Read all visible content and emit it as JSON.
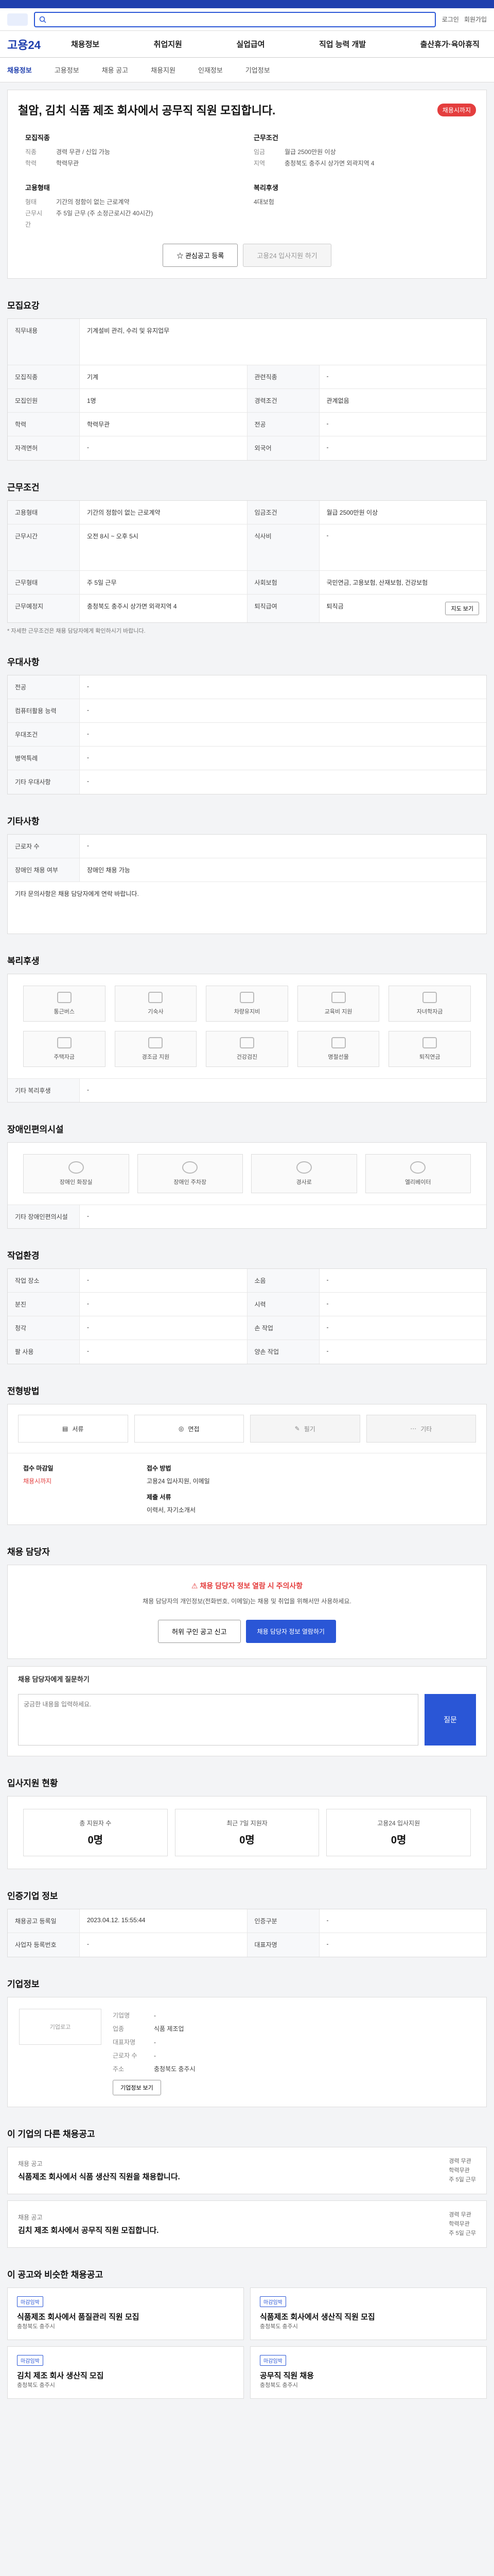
{
  "header": {
    "search_placeholder": "",
    "util": [
      "로그인",
      "회원가입"
    ]
  },
  "brand": "고용24",
  "gnb": [
    "채용정보",
    "취업지원",
    "실업급여",
    "직업 능력 개발",
    "출산휴가·육아휴직"
  ],
  "subnav": [
    "채용정보",
    "고용정보",
    "채용 공고",
    "채용지원",
    "인재정보",
    "기업정보"
  ],
  "job": {
    "deadline": "채용시까지",
    "title": "철암, 김치 식품 제조 회사에서 공무직 직원 모집합니다.",
    "summary": [
      {
        "head": "모집직종",
        "lines": [
          [
            "직종",
            "경력 무관 / 신입 가능"
          ],
          [
            "학력",
            "학력무관"
          ]
        ]
      },
      {
        "head": "근무조건",
        "lines": [
          [
            "임금",
            "월급 2500만원 이상"
          ],
          [
            "지역",
            "충청북도 충주시 상가면 외곽지역 4"
          ]
        ]
      },
      {
        "head": "고용형태",
        "lines": [
          [
            "형태",
            "기간의 정함이 없는 근로계약"
          ],
          [
            "근무시간",
            "주 5일 근무 (주 소정근로시간 40시간)"
          ]
        ]
      },
      {
        "head": "복리후생",
        "lines": [
          [
            "",
            "4대보험"
          ]
        ]
      }
    ],
    "btn_interest": "관심공고 등록",
    "btn_apply": "고용24 입사지원 하기"
  },
  "recruit": {
    "title": "모집요강",
    "duty_label": "직무내용",
    "duty": "기계설비 관리, 수리 및 유지업무",
    "rows": [
      [
        [
          "모집직종",
          "기계"
        ],
        [
          "관련직종",
          "-"
        ]
      ],
      [
        [
          "모집인원",
          "1명"
        ],
        [
          "경력조건",
          "관계없음"
        ]
      ],
      [
        [
          "학력",
          "학력무관"
        ],
        [
          "전공",
          "-"
        ]
      ],
      [
        [
          "자격면허",
          "-"
        ],
        [
          "외국어",
          "-"
        ]
      ]
    ]
  },
  "conditions": {
    "title": "근무조건",
    "rows": [
      [
        [
          "고용형태",
          "기간의 정함이 없는 근로계약"
        ],
        [
          "임금조건",
          "월급 2500만원 이상"
        ]
      ],
      [
        [
          "근무시간",
          "오전 8시 ~ 오후 5시"
        ],
        [
          "식사비",
          "-"
        ]
      ],
      [
        [
          "근무형태",
          "주 5일 근무"
        ],
        [
          "사회보험",
          "국민연금, 고용보험, 산재보험, 건강보험"
        ]
      ],
      [
        [
          "근무예정지",
          "충청북도 충주시 상가면 외곽지역 4"
        ],
        [
          "퇴직급여",
          "퇴직금"
        ]
      ]
    ],
    "map_label": "지도 보기",
    "note": "* 자세한 근무조건은 채용 담당자에게 확인하시기 바랍니다."
  },
  "preference": {
    "title": "우대사항",
    "rows": [
      [
        "전공",
        "-"
      ],
      [
        "컴퓨터활용 능력",
        "-"
      ],
      [
        "우대조건",
        "-"
      ],
      [
        "병역특례",
        "-"
      ],
      [
        "기타 우대사항",
        "-"
      ]
    ]
  },
  "other": {
    "title": "기타사항",
    "rows": [
      [
        "근로자 수",
        "-"
      ],
      [
        "장애인 채용 여부",
        "장애인 채용 가능"
      ]
    ],
    "text": "기타 문의사항은 채용 담당자에게 연락 바랍니다."
  },
  "benefits": {
    "title": "복리후생",
    "items": [
      "통근버스",
      "기숙사",
      "차량유지비",
      "교육비 지원",
      "자녀학자금",
      "주택자금",
      "경조금 지원",
      "건강검진",
      "명절선물",
      "퇴직연금"
    ],
    "other_label": "기타 복리후생",
    "other_value": "-"
  },
  "disability": {
    "title": "장애인편의시설",
    "items": [
      "장애인 화장실",
      "장애인 주차장",
      "경사로",
      "엘리베이터"
    ],
    "other_label": "기타 장애인편의시설",
    "other_value": "-"
  },
  "workplace": {
    "title": "작업환경",
    "rows": [
      [
        [
          "작업 장소",
          "-"
        ],
        [
          "소음",
          "-"
        ]
      ],
      [
        [
          "분진",
          "-"
        ],
        [
          "시력",
          "-"
        ]
      ],
      [
        [
          "청각",
          "-"
        ],
        [
          "손 작업",
          "-"
        ]
      ],
      [
        [
          "팔 사용",
          "-"
        ],
        [
          "양손 작업",
          "-"
        ]
      ]
    ]
  },
  "selection": {
    "title": "전형방법",
    "methods": [
      "서류",
      "면접",
      "필기",
      "기타"
    ],
    "period_label": "접수 마감일",
    "period_value": "채용시까지",
    "apply_label": "접수 방법",
    "apply_value": "고용24 입사지원, 이메일",
    "doc_label": "제출 서류",
    "doc_value": "이력서, 자기소개서"
  },
  "contact": {
    "title": "채용 담당자",
    "warn_title": "채용 담당자 정보 열람 시 주의사항",
    "warn_text": "채용 담당자의 개인정보(전화번호, 이메일)는 채용 및 취업을 위해서만 사용하세요.",
    "btn_view": "채용 담당자 정보 열람하기",
    "btn_report": "허위 구인 공고 신고"
  },
  "qa": {
    "title": "채용 담당자에게 질문하기",
    "placeholder": "궁금한 내용을 입력하세요.",
    "submit": "질문"
  },
  "stats": {
    "title": "입사지원 현황",
    "items": [
      [
        "총 지원자 수",
        "0명"
      ],
      [
        "최근 7일 지원자",
        "0명"
      ],
      [
        "고용24 입사지원",
        "0명"
      ]
    ]
  },
  "info": {
    "title": "인증기업 정보",
    "rows": [
      [
        [
          "채용공고 등록일",
          "2023.04.12. 15:55:44"
        ],
        [
          "인증구분",
          "-"
        ]
      ],
      [
        [
          "사업자 등록번호",
          "-"
        ],
        [
          "대표자명",
          "-"
        ]
      ]
    ]
  },
  "company": {
    "title": "기업정보",
    "logo": "기업로고",
    "rows": [
      [
        "기업명",
        "-"
      ],
      [
        "업종",
        "식품 제조업"
      ],
      [
        "대표자명",
        "-"
      ],
      [
        "근로자 수",
        "-"
      ],
      [
        "주소",
        "충청북도 충주시"
      ]
    ],
    "btn": "기업정보 보기"
  },
  "related": {
    "title": "이 기업의 다른 채용공고",
    "cards": [
      {
        "name": "채용 공고",
        "title": "식품제조 회사에서 식품 생산직 직원을 채용합니다.",
        "meta": [
          "경력 무관",
          "학력무관",
          "주 5일 근무"
        ]
      },
      {
        "name": "채용 공고",
        "title": "김치 제조 회사에서 공무직 직원 모집합니다.",
        "meta": [
          "경력 무관",
          "학력무관",
          "주 5일 근무"
        ]
      }
    ]
  },
  "recommend": {
    "title": "이 공고와 비슷한 채용공고",
    "cards": [
      {
        "badge": "마감임박",
        "title": "식품제조 회사에서 품질관리 직원 모집",
        "meta": "충청북도 충주시"
      },
      {
        "badge": "마감임박",
        "title": "식품제조 회사에서 생산직 직원 모집",
        "meta": "충청북도 충주시"
      },
      {
        "badge": "마감임박",
        "title": "김치 제조 회사 생산직 모집",
        "meta": "충청북도 충주시"
      },
      {
        "badge": "마감임박",
        "title": "공무직 직원 채용",
        "meta": "충청북도 충주시"
      }
    ]
  }
}
